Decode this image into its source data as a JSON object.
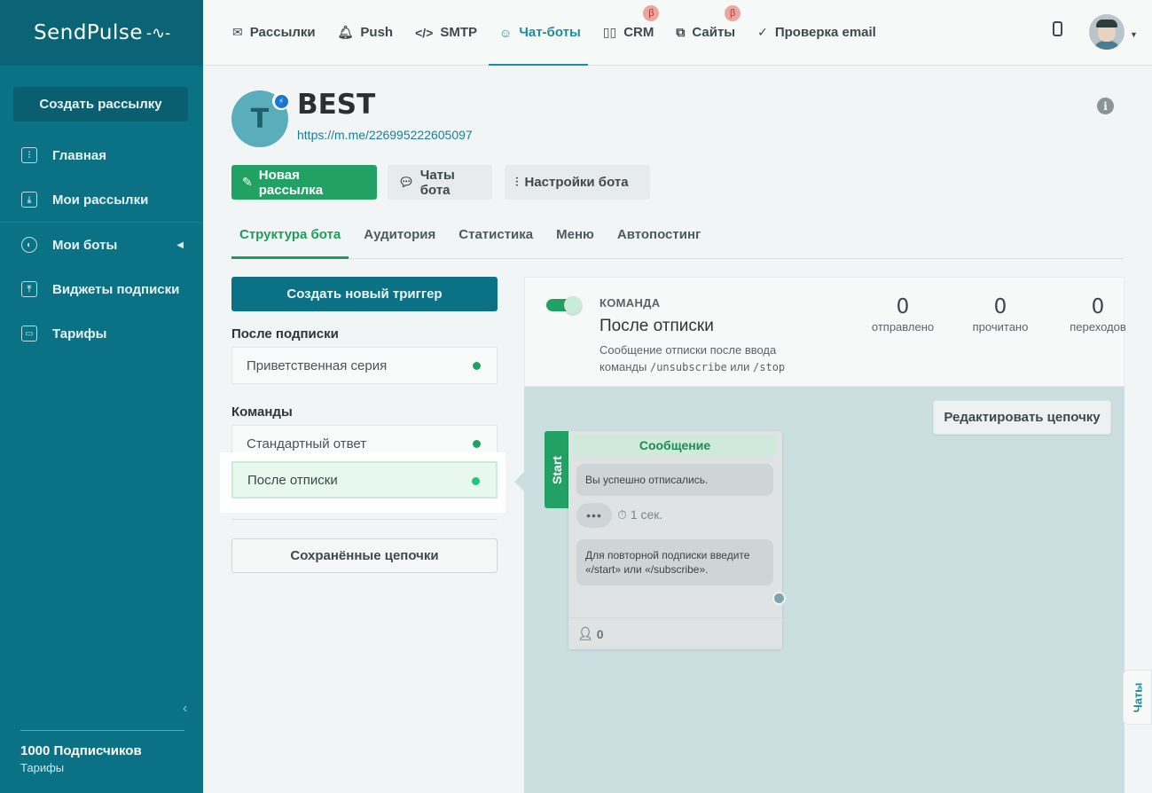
{
  "brand": {
    "logo_text": "SendPulse",
    "logo_mark": "-∿-"
  },
  "sidebar": {
    "create_button": "Создать рассылку",
    "items": [
      {
        "label": "Главная",
        "icon": "sliders-icon"
      },
      {
        "label": "Мои рассылки",
        "icon": "inbox-icon"
      },
      {
        "label": "Мои боты",
        "icon": "globe-icon"
      },
      {
        "label": "Виджеты подписки",
        "icon": "widget-icon"
      },
      {
        "label": "Тарифы",
        "icon": "wallet-icon"
      }
    ],
    "subscribers": "1000 Подписчиков",
    "tariffs_link": "Тарифы"
  },
  "topnav": {
    "items": [
      {
        "label": "Рассылки",
        "icon": "envelope-icon"
      },
      {
        "label": "Push",
        "icon": "bell-icon"
      },
      {
        "label": "SMTP",
        "icon": "code-icon"
      },
      {
        "label": "Чат-боты",
        "icon": "chatbot-icon"
      },
      {
        "label": "CRM",
        "icon": "crm-icon",
        "badge": "β"
      },
      {
        "label": "Сайты",
        "icon": "sites-icon",
        "badge": "β"
      },
      {
        "label": "Проверка email",
        "icon": "check-circle-icon"
      }
    ],
    "active": "Чат-боты"
  },
  "bot": {
    "avatar_letter": "T",
    "name": "BEST",
    "link": "https://m.me/226995222605097",
    "platform": "messenger"
  },
  "actions": {
    "new_campaign": "Новая рассылка",
    "bot_chats": "Чаты бота",
    "bot_settings": "Настройки бота"
  },
  "tabs": [
    "Структура бота",
    "Аудитория",
    "Статистика",
    "Меню",
    "Автопостинг"
  ],
  "active_tab": "Структура бота",
  "triggers": {
    "create_button": "Создать новый триггер",
    "after_subscribe_label": "После подписки",
    "after_subscribe_items": [
      "Приветственная серия"
    ],
    "commands_label": "Команды",
    "command_items": [
      "Стандартный ответ",
      "После отписки"
    ],
    "selected": "После отписки",
    "saved_chains_button": "Сохранённые цепочки"
  },
  "trigger_detail": {
    "type": "КОМАНДА",
    "title": "После отписки",
    "desc_prefix": "Сообщение отписки после ввода команды",
    "cmd1": "/unsubscribe",
    "desc_or": "или",
    "cmd2": "/stop",
    "enabled": true,
    "stats": [
      {
        "value": "0",
        "label": "отправлено"
      },
      {
        "value": "0",
        "label": "прочитано"
      },
      {
        "value": "0",
        "label": "переходов"
      }
    ]
  },
  "chain": {
    "edit_button": "Редактировать цепочку",
    "start_label": "Start",
    "card_title": "Сообщение",
    "message1": "Вы успешно отписались.",
    "typing": "•••",
    "delay": "1 сек.",
    "message2": "Для повторной подписки введите «/start» или «/subscribe».",
    "users_count": "0"
  },
  "chats_tab": "Чаты",
  "colors": {
    "sidebar": "#0b7285",
    "accent": "#1c8ca0",
    "success": "#22a164"
  }
}
